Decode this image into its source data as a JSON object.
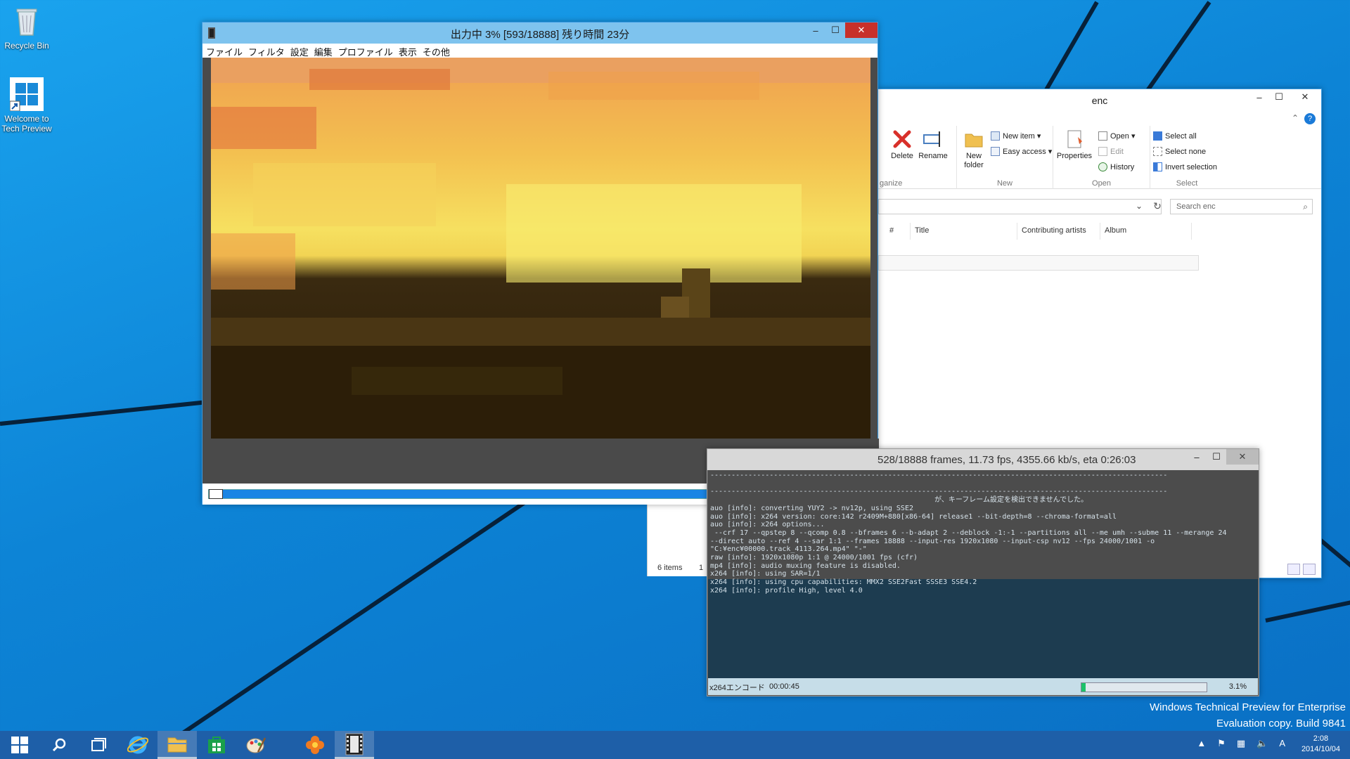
{
  "desktop": {
    "icons": [
      {
        "label": "Recycle Bin"
      },
      {
        "label": "Welcome to Tech Preview"
      }
    ],
    "watermark": {
      "line1": "Windows Technical Preview for Enterprise",
      "line2": "Evaluation copy. Build 9841"
    }
  },
  "aviutl": {
    "title": "出力中 3% [593/18888] 残り時間 23分",
    "menu": [
      "ファイル",
      "フィルタ",
      "設定",
      "編集",
      "プロファイル",
      "表示",
      "その他"
    ],
    "seek_buttons": [
      "◀|",
      "|▶",
      "|◀",
      "▶|"
    ],
    "seek_progress": 0.03
  },
  "explorer": {
    "title": "enc",
    "ribbon": {
      "delete": "Delete",
      "rename": "Rename",
      "organize_label": "ganize",
      "new_folder": "New folder",
      "new_item": "New item ▾",
      "easy_access": "Easy access ▾",
      "new_label": "New",
      "properties": "Properties",
      "open": "Open ▾",
      "edit": "Edit",
      "history": "History",
      "open_label": "Open",
      "select_all": "Select all",
      "select_none": "Select none",
      "invert_selection": "Invert selection",
      "select_label": "Select"
    },
    "search_placeholder": "Search enc",
    "columns": [
      "#",
      "Title",
      "Contributing artists",
      "Album"
    ],
    "status_items": "6 items",
    "status_partial": "1"
  },
  "x264": {
    "title": "528/18888 frames, 11.73 fps, 4355.66 kb/s, eta 0:26:03",
    "log_lines": [
      "------------------------------------------------------------------------------------------------------------",
      "",
      "------------------------------------------------------------------------------------------------------------",
      "                                                     が、キーフレーム設定を検出できませんでした。",
      "auo [info]: converting YUY2 -> nv12p, using SSE2",
      "auo [info]: x264 version: core:142 r2409M+880[x86-64] release1 --bit-depth=8 --chroma-format=all",
      "auo [info]: x264 options...",
      " --crf 17 --qpstep 8 --qcomp 0.8 --bframes 6 --b-adapt 2 --deblock -1:-1 --partitions all --me umh --subme 11 --merange 24",
      "--direct auto --ref 4 --sar 1:1 --frames 18888 --input-res 1920x1080 --input-csp nv12 --fps 24000/1001 -o",
      "\"C:¥enc¥00000.track_4113.264.mp4\" \"-\"",
      "raw [info]: 1920x1080p 1:1 @ 24000/1001 fps (cfr)",
      "mp4 [info]: audio muxing feature is disabled.",
      "x264 [info]: using SAR=1/1",
      "x264 [info]: using cpu capabilities: MMX2 SSE2Fast SSSE3 SSE4.2",
      "x264 [info]: profile High, level 4.0"
    ],
    "footer_label": "x264エンコード",
    "elapsed": "00:00:45",
    "progress_pct": "3.1%",
    "progress_value": 0.031
  },
  "taskbar": {
    "clock_time": "2:08",
    "clock_date": "2014/10/04",
    "ime": "A"
  },
  "colors": {
    "desktop_blue": "#0d84d6",
    "taskbar": "#1e5fa8",
    "aviutl_titlebar": "#7ec3ee",
    "close_red": "#c7302a",
    "seek_blue": "#1a85e4",
    "progress_green": "#1cc26a"
  }
}
